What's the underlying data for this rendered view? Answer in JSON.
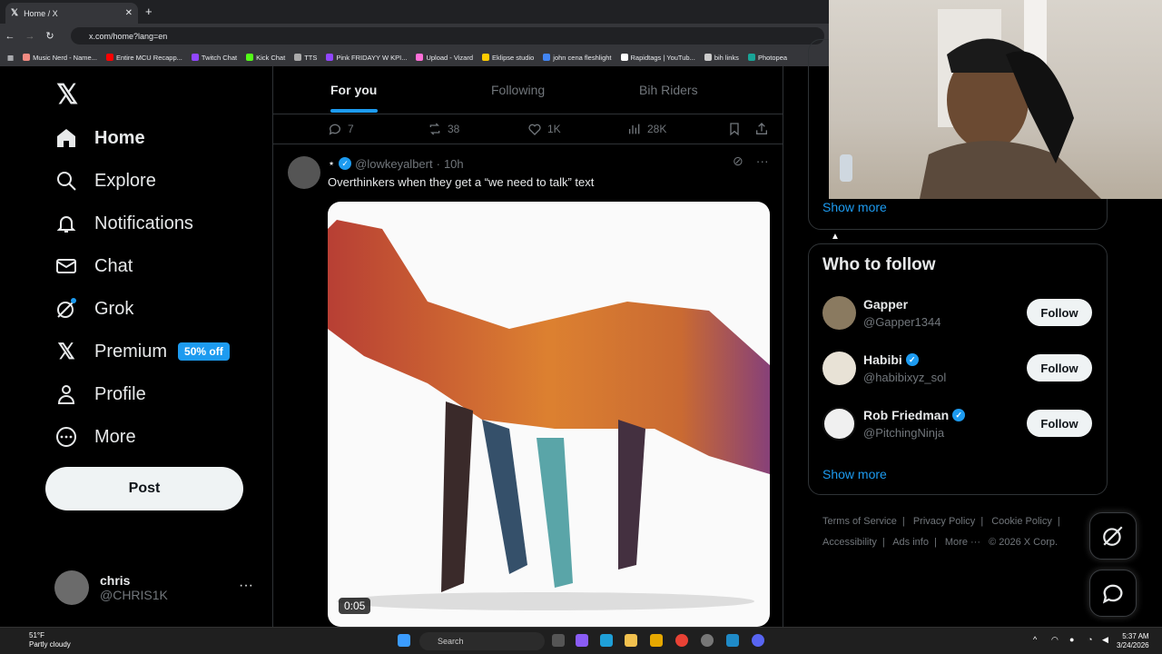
{
  "browser": {
    "tab_title": "Home / X",
    "url": "x.com/home?lang=en",
    "bookmarks": [
      {
        "label": "Music Nerd - Name...",
        "color": "#f28b82"
      },
      {
        "label": "Entire MCU Recapp...",
        "color": "#ff0000"
      },
      {
        "label": "Twitch Chat",
        "color": "#9146ff"
      },
      {
        "label": "Kick Chat",
        "color": "#53fc18"
      },
      {
        "label": "TTS",
        "color": "#aaaaaa"
      },
      {
        "label": "Pink FRIDAYY W KPI...",
        "color": "#9146ff"
      },
      {
        "label": "Upload - Vizard",
        "color": "#ff6fd8"
      },
      {
        "label": "Eklipse studio",
        "color": "#ffcc00"
      },
      {
        "label": "john cena fleshlight",
        "color": "#4285f4"
      },
      {
        "label": "Rapidtags | YouTub...",
        "color": "#ffffff"
      },
      {
        "label": "bih links",
        "color": "#cccccc"
      },
      {
        "label": "Photopea",
        "color": "#18a497"
      }
    ]
  },
  "nav": {
    "items": [
      {
        "label": "Home",
        "icon": "home-icon"
      },
      {
        "label": "Explore",
        "icon": "search-icon"
      },
      {
        "label": "Notifications",
        "icon": "bell-icon"
      },
      {
        "label": "Chat",
        "icon": "mail-icon"
      },
      {
        "label": "Grok",
        "icon": "grok-icon"
      },
      {
        "label": "Premium",
        "icon": "x-icon"
      },
      {
        "label": "Profile",
        "icon": "person-icon"
      },
      {
        "label": "More",
        "icon": "more-circle-icon"
      }
    ],
    "premium_badge": "50% off",
    "post_label": "Post",
    "account_name": "chris",
    "account_handle": "@CHRIS1K"
  },
  "feed": {
    "tabs": [
      "For you",
      "Following",
      "Bih Riders"
    ],
    "prev_actions": {
      "replies": "7",
      "reposts": "38",
      "likes": "1K",
      "views": "28K"
    },
    "tweet": {
      "handle": "@lowkeyalbert",
      "time": "10h",
      "text": "Overthinkers when they get a “we need to talk” text",
      "duration": "0:05"
    }
  },
  "sidebar": {
    "show_more": "Show more",
    "who_to_follow_title": "Who to follow",
    "follow_label": "Follow",
    "suggestions": [
      {
        "name": "Gapper",
        "handle": "@Gapper1344",
        "verified": false
      },
      {
        "name": "Habibi",
        "handle": "@habibixyz_sol",
        "verified": true
      },
      {
        "name": "Rob Friedman",
        "handle": "@PitchingNinja",
        "verified": true
      }
    ],
    "footer_links": [
      "Terms of Service",
      "Privacy Policy",
      "Cookie Policy",
      "Accessibility",
      "Ads info",
      "More ···",
      "© 2026 X Corp."
    ]
  },
  "taskbar": {
    "temperature": "51°F",
    "weather": "Partly cloudy",
    "search_label": "Search",
    "time": "5:37 AM",
    "date": "3/24/2026"
  }
}
